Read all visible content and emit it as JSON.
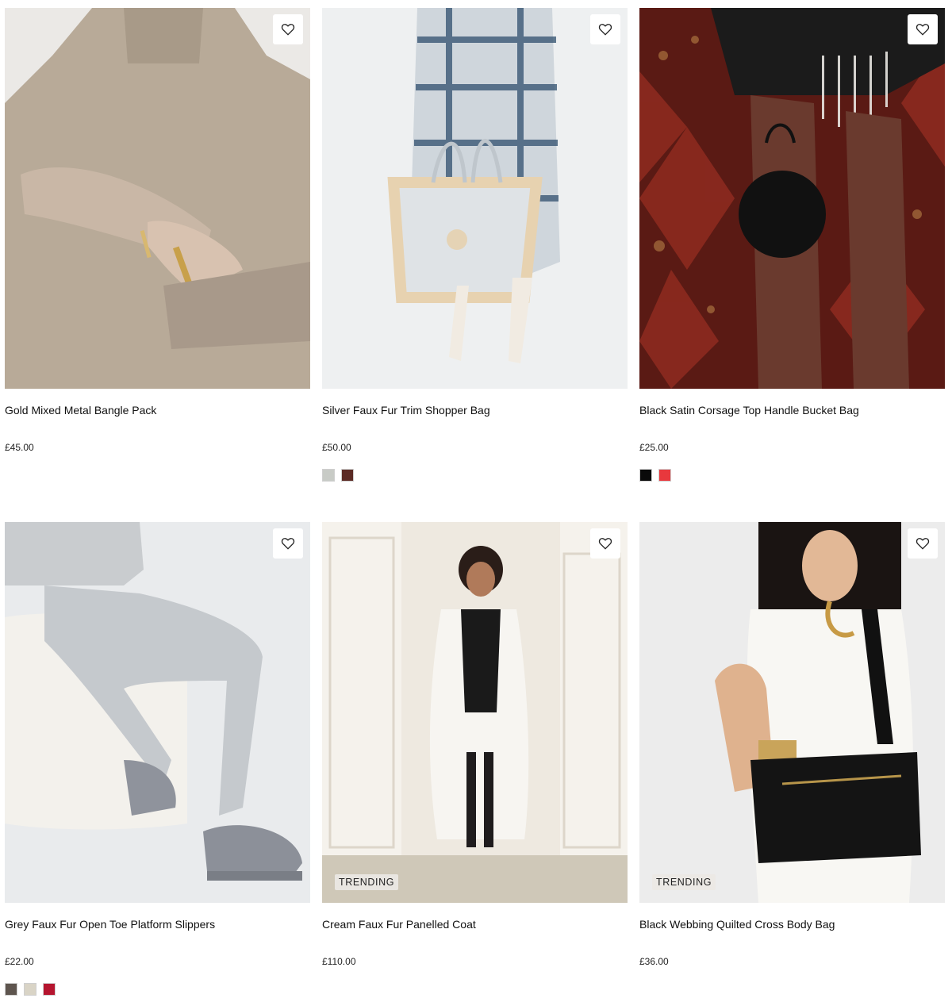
{
  "products": [
    {
      "name": "Gold Mixed Metal Bangle Pack",
      "price": "£45.00",
      "badge": "",
      "swatches": [],
      "wishlist_icon": "heart-outline-icon"
    },
    {
      "name": "Silver Faux Fur Trim Shopper Bag",
      "price": "£50.00",
      "badge": "",
      "swatches": [
        "#c8cbc6",
        "#5b2a24"
      ],
      "wishlist_icon": "heart-outline-icon"
    },
    {
      "name": "Black Satin Corsage Top Handle Bucket Bag",
      "price": "£25.00",
      "badge": "",
      "swatches": [
        "#0a0a0a",
        "#e8383d"
      ],
      "wishlist_icon": "heart-outline-icon"
    },
    {
      "name": "Grey Faux Fur Open Toe Platform Slippers",
      "price": "£22.00",
      "badge": "",
      "swatches": [
        "#5e554e",
        "#d9d4c6",
        "#b5152f"
      ],
      "wishlist_icon": "heart-outline-icon"
    },
    {
      "name": "Cream Faux Fur Panelled Coat",
      "price": "£110.00",
      "badge": "TRENDING",
      "swatches": [],
      "wishlist_icon": "heart-outline-icon"
    },
    {
      "name": "Black Webbing Quilted Cross Body Bag",
      "price": "£36.00",
      "badge": "TRENDING",
      "swatches": [],
      "wishlist_icon": "heart-outline-icon"
    }
  ]
}
